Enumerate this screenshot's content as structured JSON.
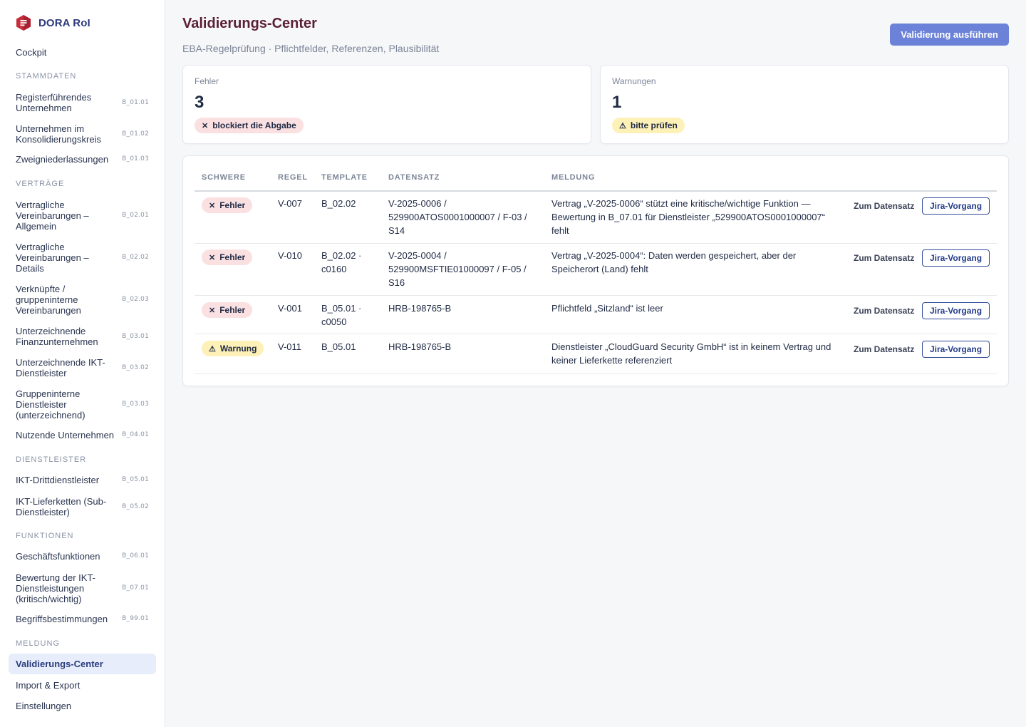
{
  "app": {
    "name": "DORA RoI"
  },
  "sidebar": {
    "top_items": [
      {
        "label": "Cockpit"
      }
    ],
    "sections": [
      {
        "title": "STAMMDATEN",
        "items": [
          {
            "label": "Registerführendes Unternehmen",
            "code": "B_01.01"
          },
          {
            "label": "Unternehmen im Konsolidierungskreis",
            "code": "B_01.02"
          },
          {
            "label": "Zweigniederlassungen",
            "code": "B_01.03"
          }
        ]
      },
      {
        "title": "VERTRÄGE",
        "items": [
          {
            "label": "Vertragliche Vereinbarungen – Allgemein",
            "code": "B_02.01"
          },
          {
            "label": "Vertragliche Vereinbarungen – Details",
            "code": "B_02.02"
          },
          {
            "label": "Verknüpfte / gruppeninterne Vereinbarungen",
            "code": "B_02.03"
          },
          {
            "label": "Unterzeichnende Finanzunternehmen",
            "code": "B_03.01"
          },
          {
            "label": "Unterzeichnende IKT-Dienstleister",
            "code": "B_03.02"
          },
          {
            "label": "Gruppeninterne Dienstleister (unterzeichnend)",
            "code": "B_03.03"
          },
          {
            "label": "Nutzende Unternehmen",
            "code": "B_04.01"
          }
        ]
      },
      {
        "title": "DIENSTLEISTER",
        "items": [
          {
            "label": "IKT-Drittdienstleister",
            "code": "B_05.01"
          },
          {
            "label": "IKT-Lieferketten (Sub-Dienstleister)",
            "code": "B_05.02"
          }
        ]
      },
      {
        "title": "FUNKTIONEN",
        "items": [
          {
            "label": "Geschäftsfunktionen",
            "code": "B_06.01"
          },
          {
            "label": "Bewertung der IKT-Dienstleistungen (kritisch/wichtig)",
            "code": "B_07.01"
          },
          {
            "label": "Begriffsbestimmungen",
            "code": "B_99.01"
          }
        ]
      },
      {
        "title": "MELDUNG",
        "items": [
          {
            "label": "Validierungs-Center",
            "active": true
          },
          {
            "label": "Import & Export"
          },
          {
            "label": "Einstellungen"
          }
        ]
      }
    ]
  },
  "header": {
    "title": "Validierungs-Center",
    "subtitle": "EBA-Regelprüfung · Pflichtfelder, Referenzen, Plausibilität",
    "run_button": "Validierung ausführen"
  },
  "stats": [
    {
      "label": "Fehler",
      "value": "3",
      "badge_icon": "✕",
      "badge": "blockiert die Abgabe",
      "tone": "red"
    },
    {
      "label": "Warnungen",
      "value": "1",
      "badge_icon": "⚠",
      "badge": "bitte prüfen",
      "tone": "yellow"
    }
  ],
  "table": {
    "columns": [
      "SCHWERE",
      "REGEL",
      "TEMPLATE",
      "DATENSATZ",
      "MELDUNG"
    ],
    "rows": [
      {
        "severity": "Fehler",
        "severity_icon": "✕",
        "tone": "red",
        "rule": "V-007",
        "template": [
          "B_02.02"
        ],
        "record": [
          "V-2025-0006 /",
          "529900ATOS0001000007 / F-03 /",
          "S14"
        ],
        "message": [
          "Vertrag „V-2025-0006“ stützt eine kritische/wichtige Funktion —",
          "Bewertung in B_07.01 für Dienstleister „529900ATOS0001000007“",
          "fehlt"
        ],
        "action_link": "Zum Datensatz",
        "action_button": "Jira-Vorgang"
      },
      {
        "severity": "Fehler",
        "severity_icon": "✕",
        "tone": "red",
        "rule": "V-010",
        "template": [
          "B_02.02 ·",
          "c0160"
        ],
        "record": [
          "V-2025-0004 /",
          "529900MSFTIE01000097 / F-05 /",
          "S16"
        ],
        "message": [
          "Vertrag „V-2025-0004“: Daten werden gespeichert, aber der",
          "Speicherort (Land) fehlt"
        ],
        "action_link": "Zum Datensatz",
        "action_button": "Jira-Vorgang"
      },
      {
        "severity": "Fehler",
        "severity_icon": "✕",
        "tone": "red",
        "rule": "V-001",
        "template": [
          "B_05.01 ·",
          "c0050"
        ],
        "record": [
          "HRB-198765-B"
        ],
        "message": [
          "Pflichtfeld „Sitzland“ ist leer"
        ],
        "action_link": "Zum Datensatz",
        "action_button": "Jira-Vorgang"
      },
      {
        "severity": "Warnung",
        "severity_icon": "⚠",
        "tone": "yellow",
        "rule": "V-011",
        "template": [
          "B_05.01"
        ],
        "record": [
          "HRB-198765-B"
        ],
        "message": [
          "Dienstleister „CloudGuard Security GmbH“ ist in keinem Vertrag und",
          "keiner Lieferkette referenziert"
        ],
        "action_link": "Zum Datensatz",
        "action_button": "Jira-Vorgang"
      }
    ]
  },
  "colors": {
    "brand": "#2d3a7c",
    "title": "#5a1f35",
    "primary": "#6b82d8",
    "error_bg": "#fbe0e2",
    "warning_bg": "#fdf1b8",
    "active_nav_bg": "#e8edfb"
  }
}
